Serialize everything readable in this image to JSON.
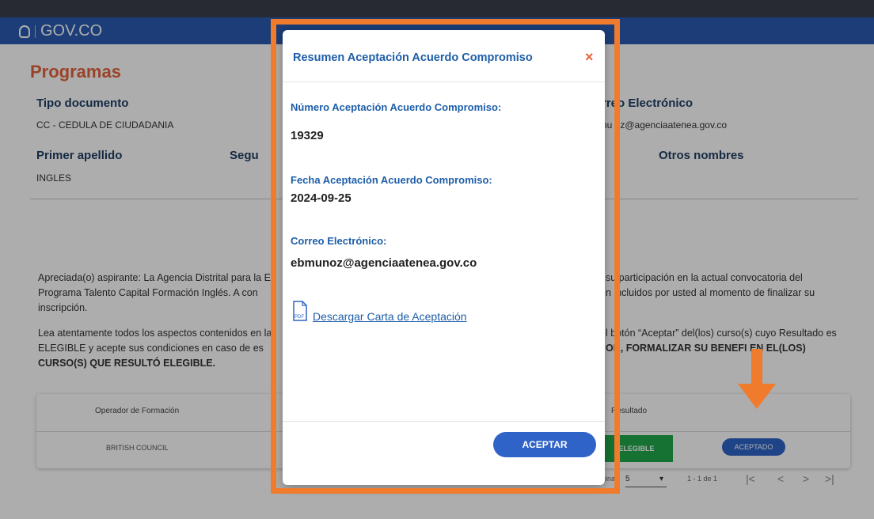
{
  "header": {
    "brand": "GOV.CO"
  },
  "page": {
    "title": "Programas",
    "fields": {
      "tipo_documento_label": "Tipo documento",
      "tipo_documento_value": "CC - CEDULA DE CIUDADANIA",
      "correo_label_partial": "rreo Electrónico",
      "correo_value_partial": "nu  oz@agenciaatenea.gov.co",
      "primer_apellido_label": "Primer apellido",
      "primer_apellido_value": "INGLES",
      "segundo_label_partial": "Segu",
      "otros_nombres_label": "Otros nombres"
    },
    "paragraph1": {
      "left": "Apreciada(o) aspirante: La Agencia Distrital para la E",
      "right": "su participación en la actual convocatoria del",
      "left2": "Programa Talento Capital Formación Inglés. A con",
      "right2": "n incluidos por usted al momento de finalizar su",
      "line3": "inscripción."
    },
    "paragraph2": {
      "left": "Lea atentamente todos los aspectos contenidos en la",
      "right": "l botón “Aceptar” del(los) curso(s) cuyo Resultado es",
      "left2": "ELEGIBLE y acepte sus condiciones en caso de es",
      "right2": "OR, FORMALIZAR SU BENEFI    EN EL(LOS)",
      "line3": "CURSO(S) QUE RESULTÓ ELEGIBLE."
    },
    "table": {
      "col_operador": "Operador de Formación",
      "col_resultado": "Resultado",
      "row_operador": "BRITISH COUNCIL",
      "row_elegible": "ELEGIBLE",
      "row_accion": "ACEPTADO"
    },
    "pager": {
      "label": "Registros por página",
      "per_page": "5",
      "range": "1 - 1 de 1"
    }
  },
  "modal": {
    "title": "Resumen Aceptación Acuerdo Compromiso",
    "close": "×",
    "numero_label": "Número Aceptación Acuerdo Compromiso:",
    "numero_value": "19329",
    "fecha_label": "Fecha Aceptación Acuerdo Compromiso:",
    "fecha_value": "2024-09-25",
    "correo_label": "Correo Electrónico:",
    "correo_value": "ebmunoz@agenciaatenea.gov.co",
    "pdf_icon_text": "PDF",
    "download_link": "Descargar Carta de Aceptación",
    "accept_button": "ACEPTAR"
  },
  "annotation": {
    "color": "#f07b2d"
  }
}
